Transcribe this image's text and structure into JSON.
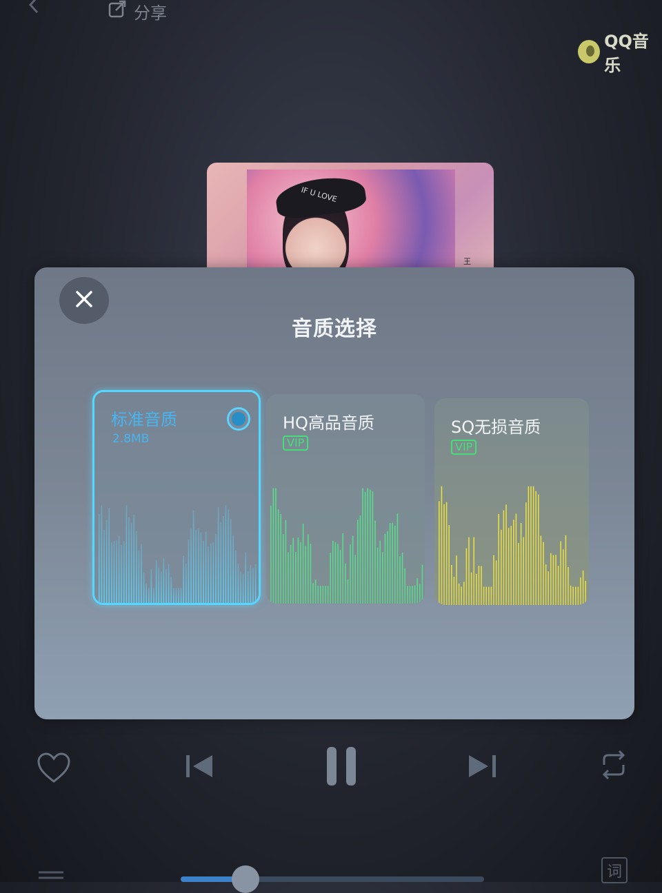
{
  "topbar": {
    "share_label": "分享",
    "brand_label": "QQ音乐"
  },
  "album": {
    "hat_text": "IF U LOVE",
    "side_text": "王心"
  },
  "dialog": {
    "title": "音质选择",
    "options": [
      {
        "label": "标准音质",
        "size": "2.8MB",
        "selected": true,
        "color": "#56d7ff"
      },
      {
        "label": "HQ高品音质",
        "badge": "VIP",
        "selected": false,
        "color": "#55e38a"
      },
      {
        "label": "SQ无损音质",
        "badge": "VIP",
        "selected": false,
        "color": "#f1e43a"
      }
    ]
  },
  "controls": {
    "icons": [
      "heart-icon",
      "previous-icon",
      "pause-icon",
      "next-icon",
      "repeat-icon"
    ],
    "lyric_label": "词"
  },
  "progress": {
    "fraction": 0.2
  },
  "colors": {
    "accent": "#47b5f2",
    "vip": "#43e07a"
  }
}
